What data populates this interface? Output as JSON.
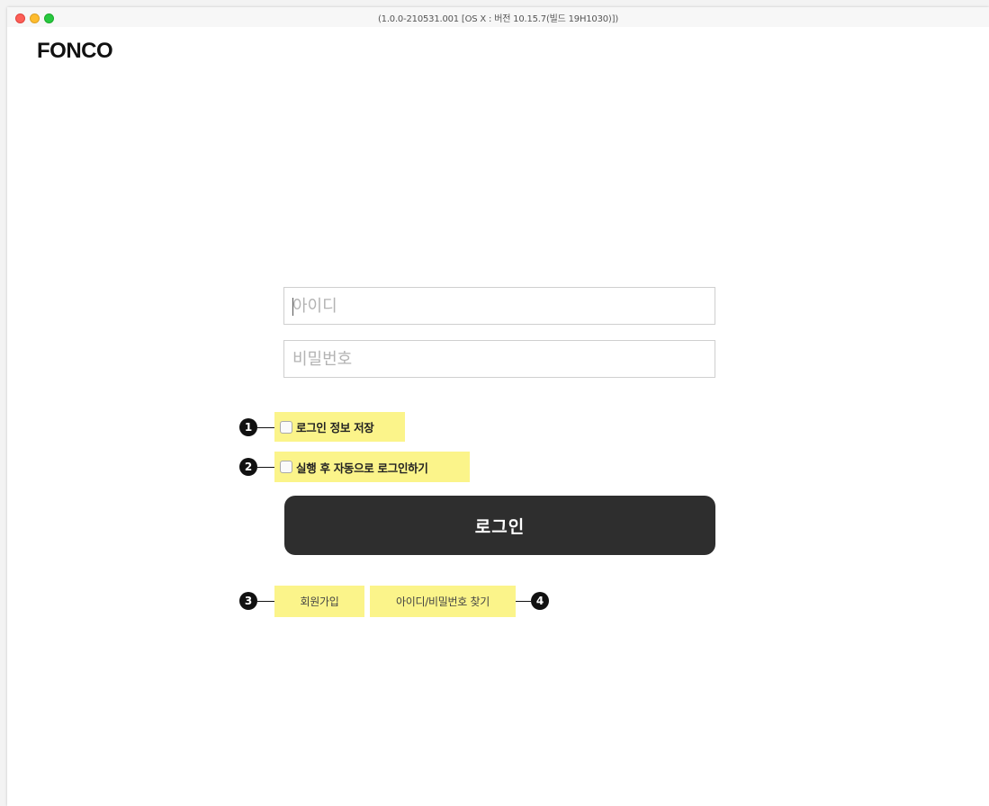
{
  "window": {
    "title": "(1.0.0-210531.001 [OS X : 버전 10.15.7(빌드 19H1030)])"
  },
  "logo": {
    "text": "FONCO"
  },
  "form": {
    "id_placeholder": "아이디",
    "id_value": "",
    "pw_placeholder": "비밀번호",
    "pw_value": "",
    "save_login_label": "로그인 정보 저장",
    "save_login_checked": false,
    "auto_login_label": "실행 후 자동으로 로그인하기",
    "auto_login_checked": false,
    "login_button": "로그인"
  },
  "links": {
    "signup": "회원가입",
    "find_account": "아이디/비밀번호 찾기"
  },
  "annotations": {
    "badge1": "1",
    "badge2": "2",
    "badge3": "3",
    "badge4": "4"
  },
  "colors": {
    "highlight": "#fbf48a",
    "button_bg": "#2e2e2e",
    "badge_bg": "#111111"
  }
}
